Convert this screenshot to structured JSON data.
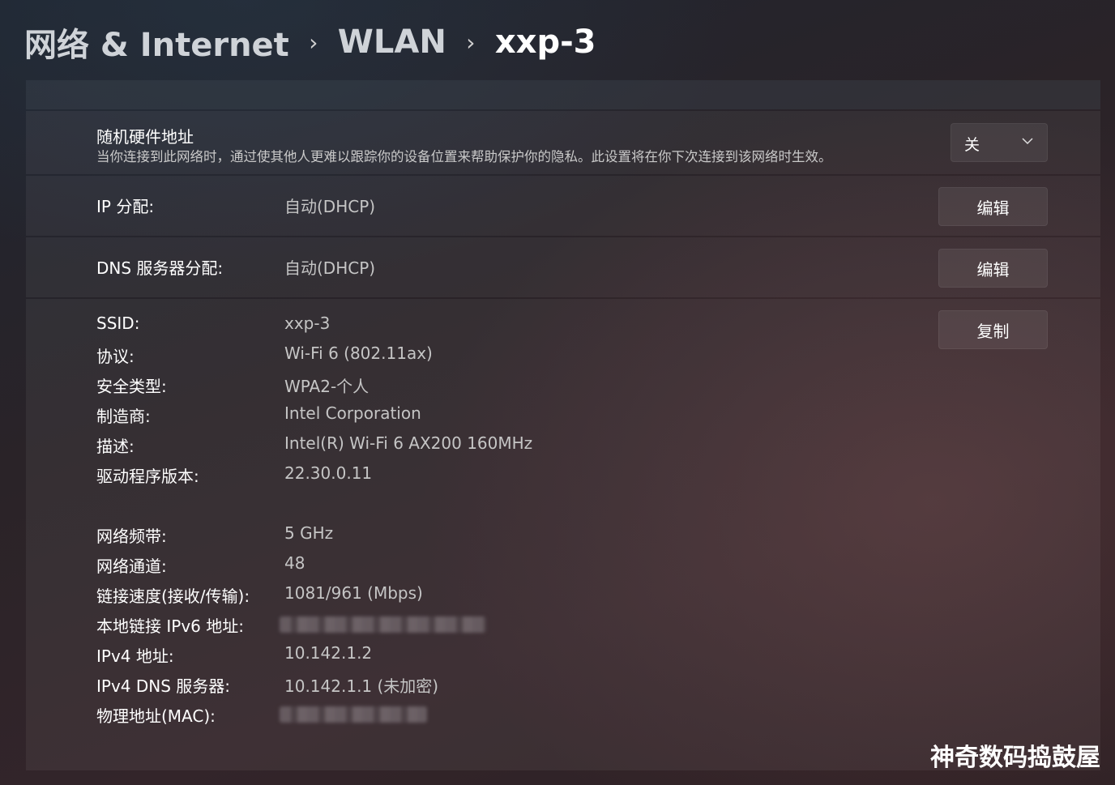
{
  "breadcrumb": {
    "items": [
      "网络 & Internet",
      "WLAN",
      "xxp-3"
    ],
    "separator": "›"
  },
  "random_mac": {
    "title": "随机硬件地址",
    "description": "当你连接到此网络时，通过使其他人更难以跟踪你的设备位置来帮助保护你的隐私。此设置将在你下次连接到该网络时生效。",
    "value": "关"
  },
  "ip_assignment": {
    "label": "IP 分配:",
    "value": "自动(DHCP)",
    "button": "编辑"
  },
  "dns_assignment": {
    "label": "DNS 服务器分配:",
    "value": "自动(DHCP)",
    "button": "编辑"
  },
  "properties": {
    "copy_button": "复制",
    "rows": [
      {
        "label": "SSID:",
        "value": "xxp-3"
      },
      {
        "label": "协议:",
        "value": "Wi-Fi 6 (802.11ax)"
      },
      {
        "label": "安全类型:",
        "value": "WPA2-个人"
      },
      {
        "label": "制造商:",
        "value": "Intel Corporation"
      },
      {
        "label": "描述:",
        "value": "Intel(R) Wi-Fi 6 AX200 160MHz"
      },
      {
        "label": "驱动程序版本:",
        "value": "22.30.0.11"
      },
      {
        "label": "网络频带:",
        "value": "5 GHz"
      },
      {
        "label": "网络通道:",
        "value": "48"
      },
      {
        "label": "链接速度(接收/传输):",
        "value": "1081/961 (Mbps)"
      },
      {
        "label": "本地链接 IPv6 地址:",
        "value": ""
      },
      {
        "label": "IPv4 地址:",
        "value": "10.142.1.2"
      },
      {
        "label": "IPv4 DNS 服务器:",
        "value": "10.142.1.1 (未加密)"
      },
      {
        "label": "物理地址(MAC):",
        "value": ""
      }
    ]
  },
  "watermark": "神奇数码捣鼓屋",
  "icons": {
    "dropdown": "chevron-down-icon"
  },
  "colors": {
    "text_primary": "#ffffff",
    "text_secondary": "#c5c5c5"
  }
}
